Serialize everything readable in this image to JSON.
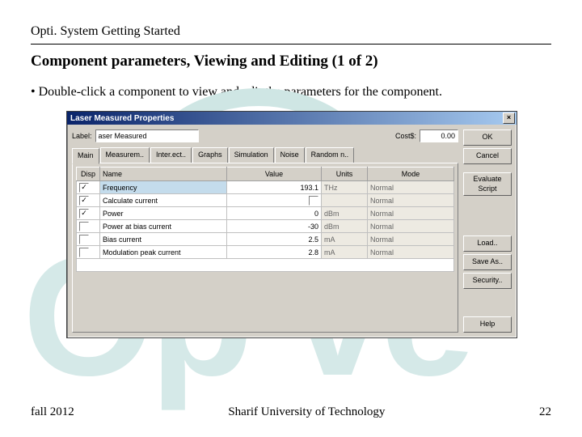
{
  "doc_title": "Opti. System Getting Started",
  "heading": "Component parameters, Viewing and Editing (1 of 2)",
  "bullet": "• Double-click a component to view and edit the parameters for the component.",
  "watermark": "Op    ve",
  "dialog": {
    "title": "Laser Measured Properties",
    "close": "×",
    "label_lab": "Label:",
    "label_val": "aser Measured",
    "cost_lab": "Cost$:",
    "cost_val": "0.00",
    "tabs": [
      "Main",
      "Measurem..",
      "Inter.ect..",
      "Graphs",
      "Simulation",
      "Noise",
      "Random n.."
    ],
    "cols": {
      "disp": "Disp",
      "name": "Name",
      "value": "Value",
      "units": "Units",
      "mode": "Mode"
    },
    "rows": [
      {
        "chk": "✓",
        "name": "Frequency",
        "value": "193.1",
        "units": "THz",
        "mode": "Normal"
      },
      {
        "chk": "✓",
        "name": "Calculate current",
        "value_chk": true,
        "units": "",
        "mode": "Normal"
      },
      {
        "chk": "✓",
        "name": "Power",
        "value": "0",
        "units": "dBm",
        "mode": "Normal"
      },
      {
        "chk": "",
        "name": "Power at bias current",
        "value": "-30",
        "units": "dBm",
        "mode": "Normal"
      },
      {
        "chk": "",
        "name": "Bias current",
        "value": "2.5",
        "units": "mA",
        "mode": "Normal"
      },
      {
        "chk": "",
        "name": "Modulation peak current",
        "value": "2.8",
        "units": "mA",
        "mode": "Normal"
      }
    ],
    "buttons": {
      "ok": "OK",
      "cancel": "Cancel",
      "eval": "Evaluate Script",
      "load": "Load..",
      "save": "Save As..",
      "security": "Security..",
      "help": "Help"
    }
  },
  "footer": {
    "left": "fall 2012",
    "center": "Sharif University of Technology",
    "right": "22"
  }
}
